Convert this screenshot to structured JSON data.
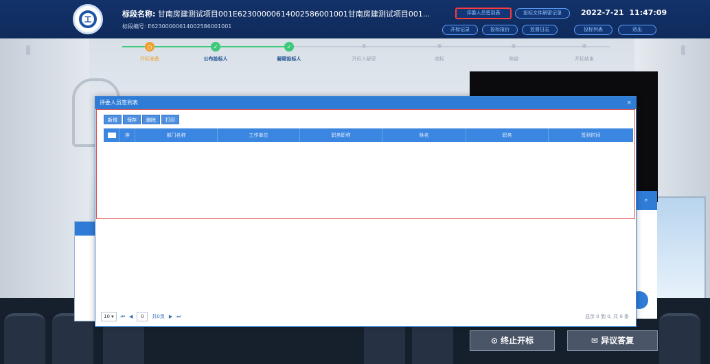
{
  "header": {
    "project_name_label": "标段名称:",
    "project_name": "甘南房建测试项目001E62300000614002586001001甘南房建测试项目001...",
    "project_code_label": "标段编号:",
    "project_code": "E62300000614002586001001",
    "buttons": [
      "评委人员签到表",
      "投标文件解密记录",
      "开标记录",
      "投标报价",
      "监督日志",
      "投标列表",
      "退出"
    ],
    "date": "2022-7-21",
    "time": "11:47:09",
    "logo_icon": "emblem-icon"
  },
  "progress": {
    "steps": [
      {
        "label": "开标准备",
        "state": "current"
      },
      {
        "label": "公布投标人",
        "state": "done"
      },
      {
        "label": "解密投标人",
        "state": "done"
      },
      {
        "label": "开标人解密",
        "state": "todo"
      },
      {
        "label": "唱标",
        "state": "todo"
      },
      {
        "label": "答疑",
        "state": "todo"
      },
      {
        "label": "开标结束",
        "state": "todo"
      }
    ]
  },
  "modal": {
    "title": "评委人员签到表",
    "close": "×",
    "toolbar": [
      "新增",
      "保存",
      "删除",
      "打印"
    ],
    "columns": [
      "序",
      "部门名称",
      "工作单位",
      "职务职称",
      "姓名",
      "职务",
      "签到时间"
    ],
    "pager": {
      "page_size": "10",
      "page": "0",
      "of_label": "共0页",
      "info": "显示 0 到 0, 共 0 条"
    }
  },
  "bottom": {
    "stop_button": "终止开标",
    "objection_button": "异议答复"
  },
  "colors": {
    "header_bg": "#13326a",
    "accent": "#2e7cd6",
    "progress_done": "#3ec97a",
    "progress_current": "#f0a030",
    "highlight": "#ff3b3b"
  }
}
